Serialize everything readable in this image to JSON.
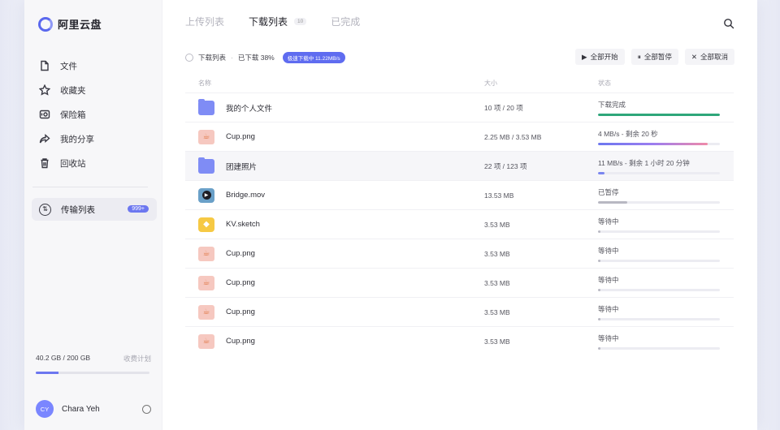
{
  "app": {
    "logo_text": "阿里云盘"
  },
  "sidebar": {
    "items": [
      {
        "label": "文件",
        "icon": "file-icon"
      },
      {
        "label": "收藏夹",
        "icon": "star-icon"
      },
      {
        "label": "保险箱",
        "icon": "safe-icon"
      },
      {
        "label": "我的分享",
        "icon": "share-icon"
      },
      {
        "label": "回收站",
        "icon": "trash-icon"
      }
    ],
    "transfer": {
      "label": "传输列表",
      "badge": "999+"
    },
    "storage": {
      "used": "40.2 GB / 200 GB",
      "plan": "收费计划",
      "fraction": 0.201
    },
    "user": {
      "initials": "CY",
      "name": "Chara Yeh"
    }
  },
  "tabs": {
    "upload": "上传列表",
    "download": "下载列表",
    "download_count": "10",
    "done": "已完成"
  },
  "toolbar": {
    "list_label": "下载列表",
    "downloaded": "已下载 38%",
    "speed": "极速下载中 11.22MB/s",
    "start_all": "全部开始",
    "pause_all": "全部暂停",
    "cancel_all": "全部取消"
  },
  "table": {
    "headers": {
      "name": "名称",
      "size": "大小",
      "status": "状态"
    },
    "rows": [
      {
        "name": "我的个人文件",
        "type": "folder",
        "size": "10 项 / 20 项",
        "status": "下载完成",
        "progress": 1.0,
        "color": "#2ea67a"
      },
      {
        "name": "Cup.png",
        "type": "image",
        "size": "2.25 MB / 3.53 MB",
        "status": "4 MB/s - 剩余 20 秒",
        "progress": 0.9,
        "color": "gradient"
      },
      {
        "name": "团建照片",
        "type": "folder",
        "size": "22 项 / 123 项",
        "status": "11 MB/s - 剩余 1 小时 20 分钟",
        "progress": 0.05,
        "color": "#7a86f0"
      },
      {
        "name": "Bridge.mov",
        "type": "video",
        "size": "13.53 MB",
        "status": "已暂停",
        "progress": 0.24,
        "color": "#b8b8c2"
      },
      {
        "name": "KV.sketch",
        "type": "sketch",
        "size": "3.53 MB",
        "status": "等待中",
        "progress": 0.02,
        "color": "#b8b8c2"
      },
      {
        "name": "Cup.png",
        "type": "image",
        "size": "3.53 MB",
        "status": "等待中",
        "progress": 0.02,
        "color": "#b8b8c2"
      },
      {
        "name": "Cup.png",
        "type": "image",
        "size": "3.53 MB",
        "status": "等待中",
        "progress": 0.02,
        "color": "#b8b8c2"
      },
      {
        "name": "Cup.png",
        "type": "image",
        "size": "3.53 MB",
        "status": "等待中",
        "progress": 0.02,
        "color": "#b8b8c2"
      },
      {
        "name": "Cup.png",
        "type": "image",
        "size": "3.53 MB",
        "status": "等待中",
        "progress": 0.02,
        "color": "#b8b8c2"
      }
    ],
    "highlight_index": 2
  }
}
